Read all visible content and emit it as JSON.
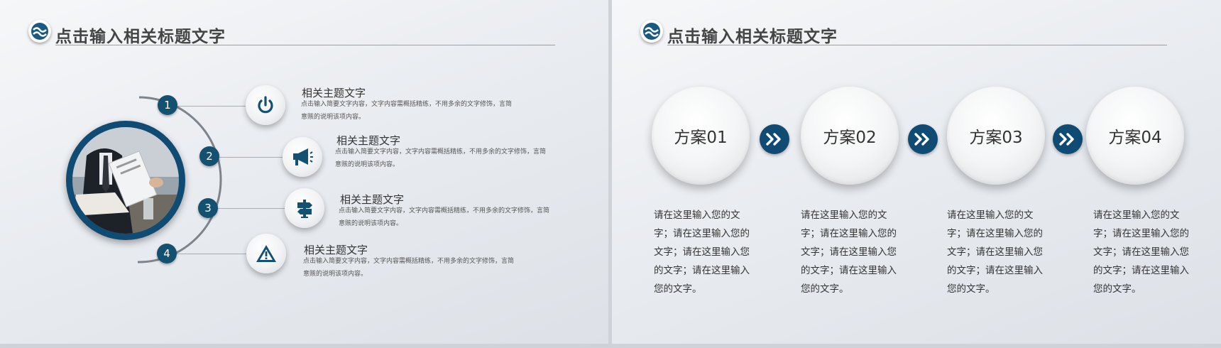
{
  "colors": {
    "accent": "#0f4b73",
    "text": "#333333"
  },
  "left_slide": {
    "title": "点击输入相关标题文字",
    "logo_icon": "wave-logo-icon",
    "photo": "business-meeting-photo",
    "items": [
      {
        "number": "1",
        "icon": "power-icon",
        "title": "相关主题文字",
        "desc": "点击输入简要文字内容，文字内容需概括精练，不用多余的文字修饰，言简意赅的说明该项内容。"
      },
      {
        "number": "2",
        "icon": "megaphone-icon",
        "title": "相关主题文字",
        "desc": "点击输入简要文字内容，文字内容需概括精练，不用多余的文字修饰，言简意赅的说明该项内容。"
      },
      {
        "number": "3",
        "icon": "signpost-icon",
        "title": "相关主题文字",
        "desc": "点击输入简要文字内容，文字内容需概括精练，不用多余的文字修饰，言简意赅的说明该项内容。"
      },
      {
        "number": "4",
        "icon": "warning-icon",
        "title": "相关主题文字",
        "desc": "点击输入简要文字内容，文字内容需概括精练，不用多余的文字修饰，言简意赅的说明该项内容。"
      }
    ]
  },
  "right_slide": {
    "title": "点击输入相关标题文字",
    "logo_icon": "wave-logo-icon",
    "arrow_icon": "double-chevron-right-icon",
    "plans": [
      {
        "label": "方案01",
        "text": "请在这里输入您的文字；请在这里输入您的文字；请在这里输入您的文字；请在这里输入您的文字。"
      },
      {
        "label": "方案02",
        "text": "请在这里输入您的文字；请在这里输入您的文字；请在这里输入您的文字；请在这里输入您的文字。"
      },
      {
        "label": "方案03",
        "text": "请在这里输入您的文字；请在这里输入您的文字；请在这里输入您的文字；请在这里输入您的文字。"
      },
      {
        "label": "方案04",
        "text": "请在这里输入您的文字；请在这里输入您的文字；请在这里输入您的文字；请在这里输入您的文字。"
      }
    ]
  }
}
